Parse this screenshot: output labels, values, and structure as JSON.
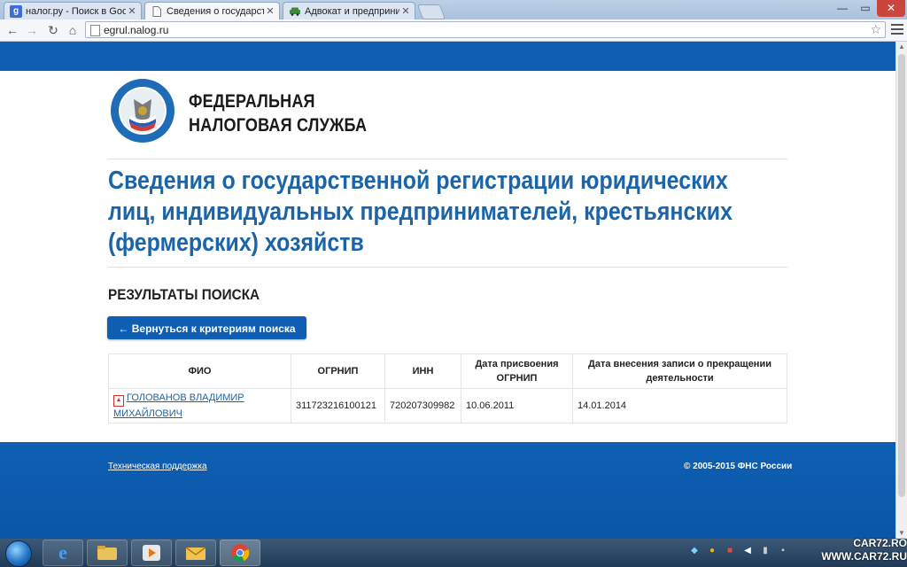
{
  "browser": {
    "tabs": [
      {
        "label": "налог.ру - Поиск в Google",
        "favicon": "google-g-icon",
        "active": false
      },
      {
        "label": "Сведения о государственной",
        "favicon": "page-icon",
        "active": true
      },
      {
        "label": "Адвокат и предприниматель",
        "favicon": "car-icon",
        "active": false
      }
    ],
    "url": "egrul.nalog.ru"
  },
  "header": {
    "org_line1": "ФЕДЕРАЛЬНАЯ",
    "org_line2": "НАЛОГОВАЯ СЛУЖБА",
    "emblem_text": "ФЕДЕРАЛЬНАЯ НАЛОГОВАЯ СЛУЖБА"
  },
  "page": {
    "title": "Сведения о государственной регистрации юридических лиц, индивидуальных предпринимателей, крестьянских (фермерских) хозяйств",
    "results_heading": "РЕЗУЛЬТАТЫ ПОИСКА",
    "back_button": "← Вернуться к критериям поиска"
  },
  "table": {
    "headers": {
      "fio": "ФИО",
      "ogrnip": "ОГРНИП",
      "inn": "ИНН",
      "date_assigned": "Дата присвоения ОГРНИП",
      "date_terminated": "Дата внесения записи о прекращении деятельности"
    },
    "rows": [
      {
        "fio": "ГОЛОВАНОВ ВЛАДИМИР МИХАЙЛОВИЧ",
        "ogrnip": "311723216100121",
        "inn": "720207309982",
        "date_assigned": "10.06.2011",
        "date_terminated": "14.01.2014"
      }
    ]
  },
  "footer": {
    "support": "Техническая поддержка",
    "copyright": "© 2005-2015 ФНС России"
  },
  "watermark": {
    "line1": "CAR72.RO",
    "line2": "WWW.CAR72.RU"
  },
  "colors": {
    "brand_blue": "#0e5fb3",
    "title_blue": "#1b64a8"
  }
}
